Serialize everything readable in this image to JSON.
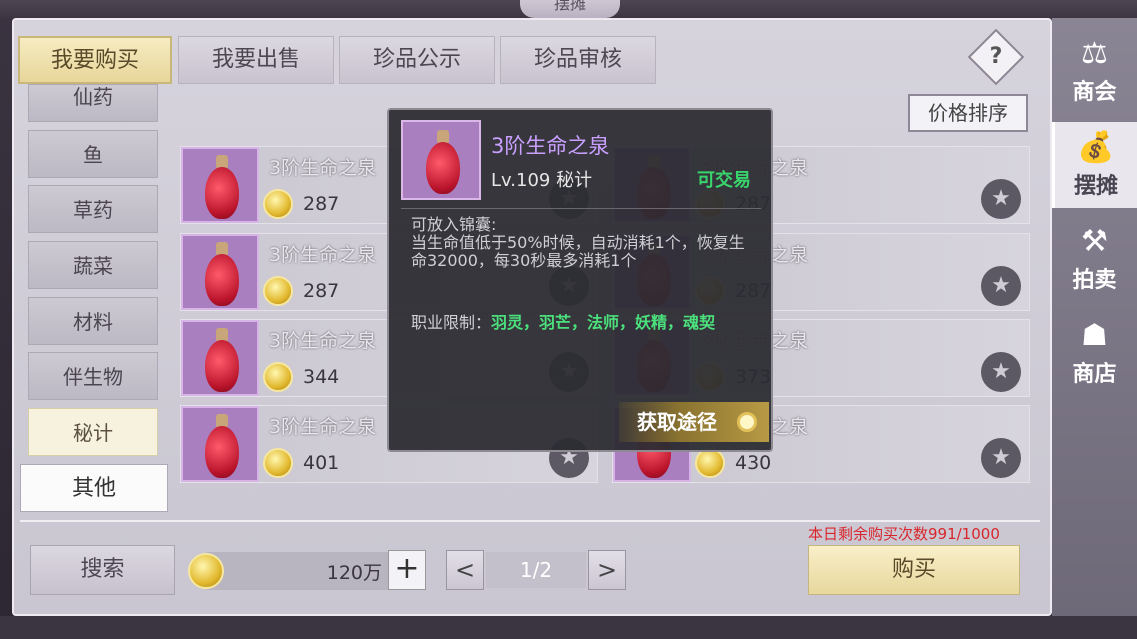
{
  "window_title": "摆摊",
  "tabs": [
    {
      "label": "我要购买",
      "active": true
    },
    {
      "label": "我要出售",
      "active": false
    },
    {
      "label": "珍品公示",
      "active": false
    },
    {
      "label": "珍品审核",
      "active": false
    }
  ],
  "help_label": "?",
  "sort_button": "价格排序",
  "categories": [
    {
      "label": "仙药"
    },
    {
      "label": "鱼"
    },
    {
      "label": "草药"
    },
    {
      "label": "蔬菜"
    },
    {
      "label": "材料"
    },
    {
      "label": "伴生物"
    },
    {
      "label": "秘计",
      "selected": true
    },
    {
      "label": "其他"
    }
  ],
  "items": [
    {
      "name": "3阶生命之泉",
      "price": "287"
    },
    {
      "name": "3阶生命之泉",
      "price": "287"
    },
    {
      "name": "3阶生命之泉",
      "price": "287"
    },
    {
      "name": "3阶生命之泉",
      "price": "287"
    },
    {
      "name": "3阶生命之泉",
      "price": "344"
    },
    {
      "name": "3阶生命之泉",
      "price": "373"
    },
    {
      "name": "3阶生命之泉",
      "price": "401"
    },
    {
      "name": "3阶生命之泉",
      "price": "430"
    }
  ],
  "right_nav": [
    {
      "label": "商会",
      "icon": "guild-icon"
    },
    {
      "label": "摆摊",
      "icon": "stall-icon",
      "selected": true
    },
    {
      "label": "拍卖",
      "icon": "auction-icon"
    },
    {
      "label": "商店",
      "icon": "shop-icon"
    }
  ],
  "bottom": {
    "search_label": "搜索",
    "amount": "120万",
    "plus_label": "+",
    "prev_label": "<",
    "next_label": ">",
    "page": "1/2",
    "remaining_text": "本日剩余购买次数991/1000",
    "buy_label": "购买"
  },
  "tooltip": {
    "title": "3阶生命之泉",
    "level": "Lv.109 秘计",
    "tradable": "可交易",
    "desc_line1": "可放入锦囊:",
    "desc_line2": "当生命值低于50%时候，自动消耗1个，恢复生命32000，每30秒最多消耗1个",
    "restriction_label": "职业限制：",
    "restriction_classes": "羽灵，羽芒，法师，妖精，魂契",
    "get_path_label": "获取途径"
  },
  "colors": {
    "accent_gold": "#e8d69a",
    "tooltip_title": "#c9a0ff",
    "tradable_green": "#39d46b",
    "limit_red": "#d9262c"
  }
}
